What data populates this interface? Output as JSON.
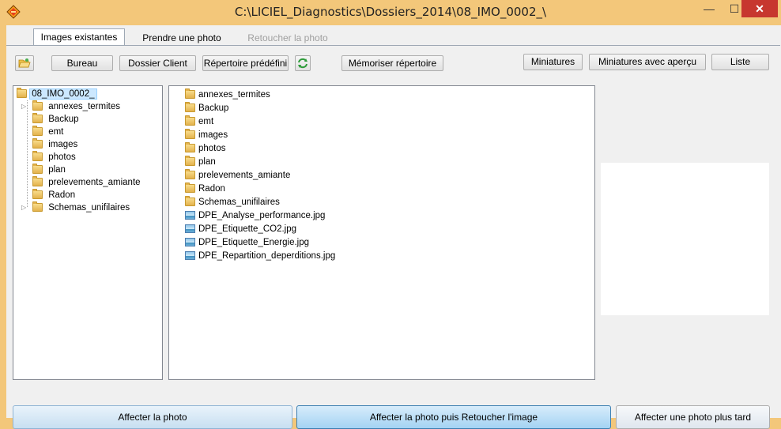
{
  "window": {
    "title": "C:\\LICIEL_Diagnostics\\Dossiers_2014\\08_IMO_0002_\\",
    "minimize_glyph": "—",
    "maximize_glyph": "☐",
    "close_glyph": "✕"
  },
  "tabs": [
    {
      "label": "Images existantes",
      "state": "active"
    },
    {
      "label": "Prendre une photo",
      "state": "normal"
    },
    {
      "label": "Retoucher la photo",
      "state": "disabled"
    }
  ],
  "toolbar": {
    "open_folder_icon": "folder-open-icon",
    "refresh_icon": "refresh-icon",
    "bureau": "Bureau",
    "dossier_client": "Dossier Client",
    "repertoire_predefini": "Répertoire prédéfini",
    "memoriser": "Mémoriser répertoire",
    "miniatures": "Miniatures",
    "miniatures_apercu": "Miniatures avec aperçu",
    "liste": "Liste"
  },
  "tree": {
    "root": "08_IMO_0002_",
    "children": [
      {
        "label": "annexes_termites",
        "expandable": true
      },
      {
        "label": "Backup",
        "expandable": false
      },
      {
        "label": "emt",
        "expandable": false
      },
      {
        "label": "images",
        "expandable": false
      },
      {
        "label": "photos",
        "expandable": false
      },
      {
        "label": "plan",
        "expandable": false
      },
      {
        "label": "prelevements_amiante",
        "expandable": false
      },
      {
        "label": "Radon",
        "expandable": false
      },
      {
        "label": "Schemas_unifilaires",
        "expandable": true
      }
    ]
  },
  "files": [
    {
      "name": "annexes_termites",
      "type": "folder"
    },
    {
      "name": "Backup",
      "type": "folder"
    },
    {
      "name": "emt",
      "type": "folder"
    },
    {
      "name": "images",
      "type": "folder"
    },
    {
      "name": "photos",
      "type": "folder"
    },
    {
      "name": "plan",
      "type": "folder"
    },
    {
      "name": "prelevements_amiante",
      "type": "folder"
    },
    {
      "name": "Radon",
      "type": "folder"
    },
    {
      "name": "Schemas_unifilaires",
      "type": "folder"
    },
    {
      "name": "DPE_Analyse_performance.jpg",
      "type": "image"
    },
    {
      "name": "DPE_Etiquette_CO2.jpg",
      "type": "image"
    },
    {
      "name": "DPE_Etiquette_Energie.jpg",
      "type": "image"
    },
    {
      "name": "DPE_Repartition_deperditions.jpg",
      "type": "image"
    }
  ],
  "actions": {
    "affecter": "Affecter la photo",
    "affecter_retoucher": "Affecter la photo puis Retoucher l'image",
    "affecter_plus_tard": "Affecter une photo plus tard"
  }
}
